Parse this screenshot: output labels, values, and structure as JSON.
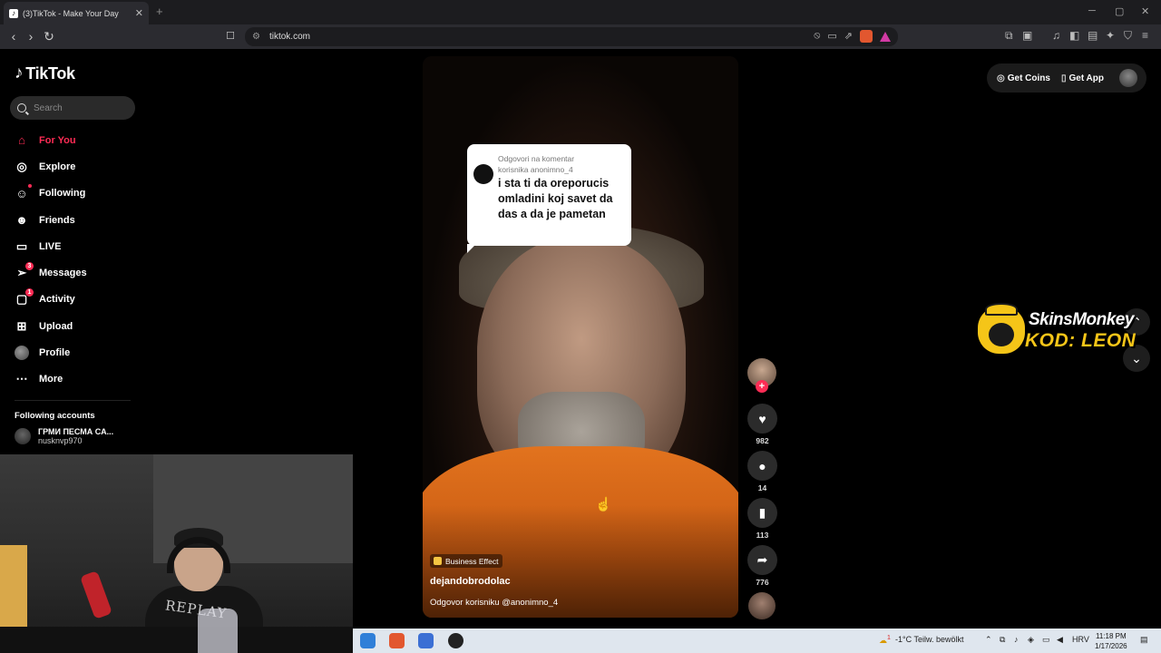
{
  "browser": {
    "tab_title": "(3)TikTok - Make Your Day",
    "tab_close": "✕",
    "new_tab": "+",
    "url": "tikto​k.com",
    "controls": {
      "minimize": "─",
      "maximize": "▢",
      "close": "✕"
    }
  },
  "sidebar": {
    "logo": "TikTok",
    "search_placeholder": "Search",
    "items": [
      {
        "label": "For You",
        "icon": "home-icon",
        "active": true
      },
      {
        "label": "Explore",
        "icon": "compass-icon"
      },
      {
        "label": "Following",
        "icon": "following-icon"
      },
      {
        "label": "Friends",
        "icon": "friends-icon"
      },
      {
        "label": "LIVE",
        "icon": "live-icon"
      },
      {
        "label": "Messages",
        "icon": "messages-icon",
        "badge": "3"
      },
      {
        "label": "Activity",
        "icon": "activity-icon",
        "badge": "1"
      },
      {
        "label": "Upload",
        "icon": "upload-icon"
      },
      {
        "label": "Profile",
        "icon": "profile-icon"
      },
      {
        "label": "More",
        "icon": "more-icon"
      }
    ],
    "following_title": "Following accounts",
    "following_account": {
      "name": "ГРМИ ПЕСМА СА...",
      "handle": "nusknvp970"
    }
  },
  "webcam": {
    "shirt_text": "REPLAY"
  },
  "video": {
    "reply_label_line1": "Odgovori na komentar",
    "reply_label_line2": "korisnika anonimno_4",
    "reply_text": "i sta ti da oreporucis omladini koj savet da das a da je pametan",
    "effect": "Business Effect",
    "author": "dejandobrodolac",
    "caption": "Odgovor korisniku @anonimno_4"
  },
  "actions": {
    "likes": "982",
    "comments": "14",
    "saves": "113",
    "shares": "776"
  },
  "topright": {
    "coins": "Get Coins",
    "app": "Get App"
  },
  "sponsor": {
    "line1": "SkinsMonkey",
    "line2": "KOD: LEON"
  },
  "taskbar": {
    "weather": "-1°C  Teilw. bewölkt",
    "weather_badge": "1",
    "lang": "HRV",
    "time": "11:18 PM",
    "date": "1/17/2026"
  },
  "colors": {
    "accent": "#fe2c55",
    "jacket": "#e2731e",
    "sponsor_yellow": "#f5c518"
  }
}
